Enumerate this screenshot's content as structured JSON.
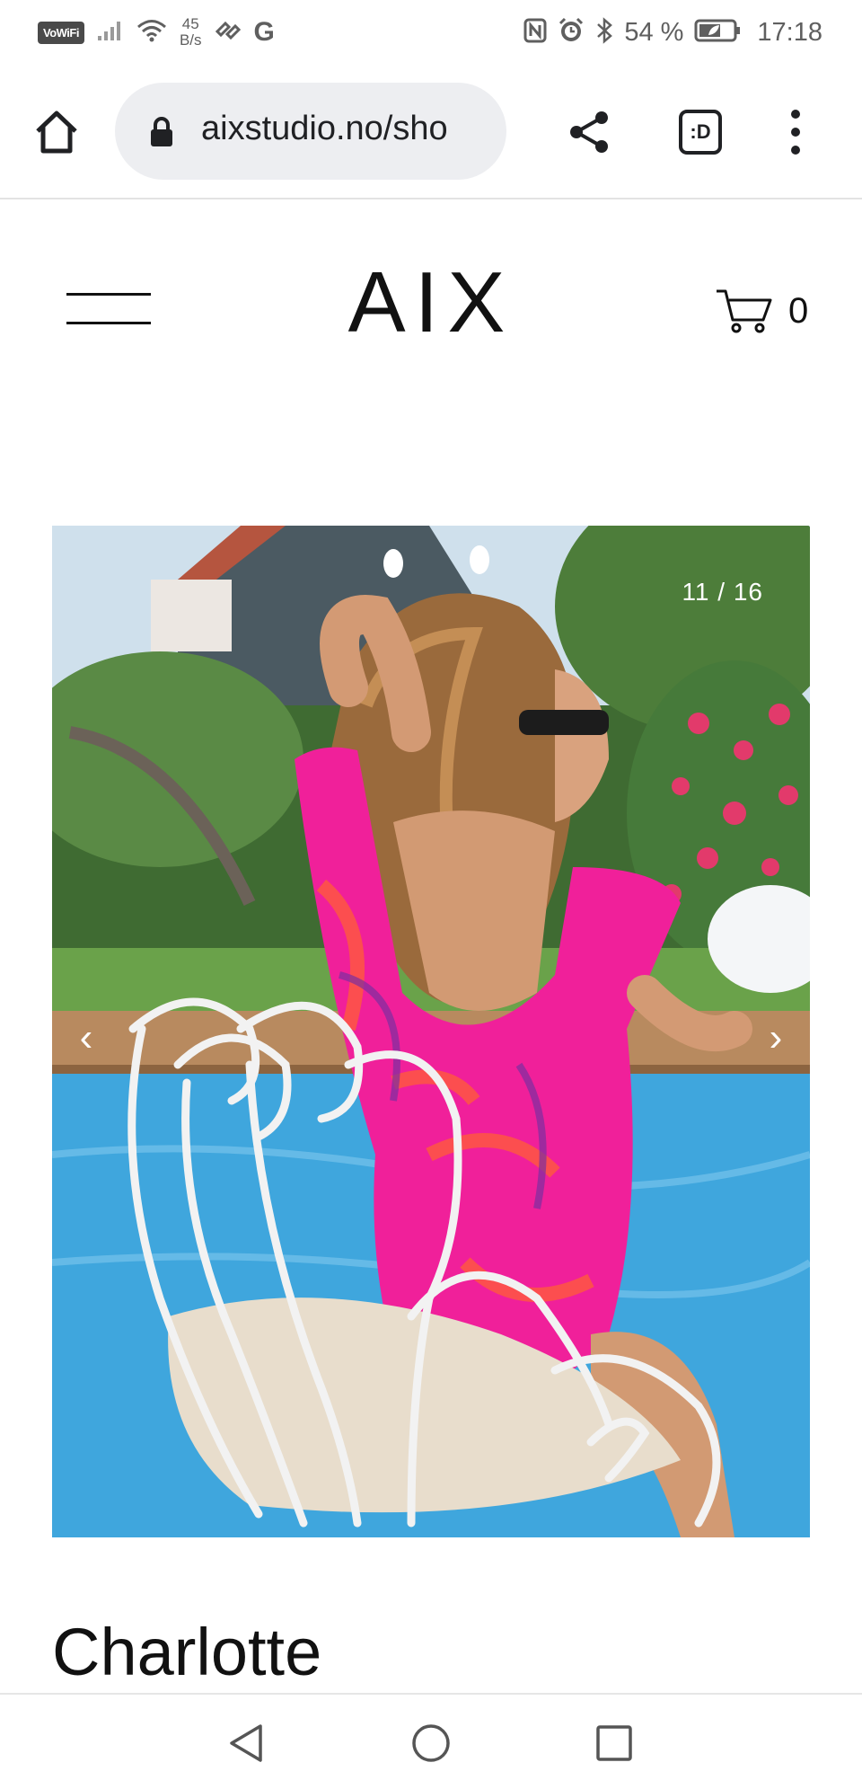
{
  "status_bar": {
    "vowifi_label": "VoWiFi",
    "net_speed_value": "45",
    "net_speed_unit": "B/s",
    "carrier_letter": "G",
    "battery_percent": "54 %",
    "time": "17:18"
  },
  "browser": {
    "url": "aixstudio.no/sho",
    "tabs_label": ":D"
  },
  "site": {
    "logo": "AIX",
    "cart_count": "0"
  },
  "gallery": {
    "counter": "11 / 16",
    "prev_arrow": "‹",
    "next_arrow": "›"
  },
  "product": {
    "title": "Charlotte"
  },
  "colors": {
    "pill_background": "#edeef1",
    "swimsuit_pink": "#f0209a",
    "pool_blue": "#3fa6dd"
  }
}
